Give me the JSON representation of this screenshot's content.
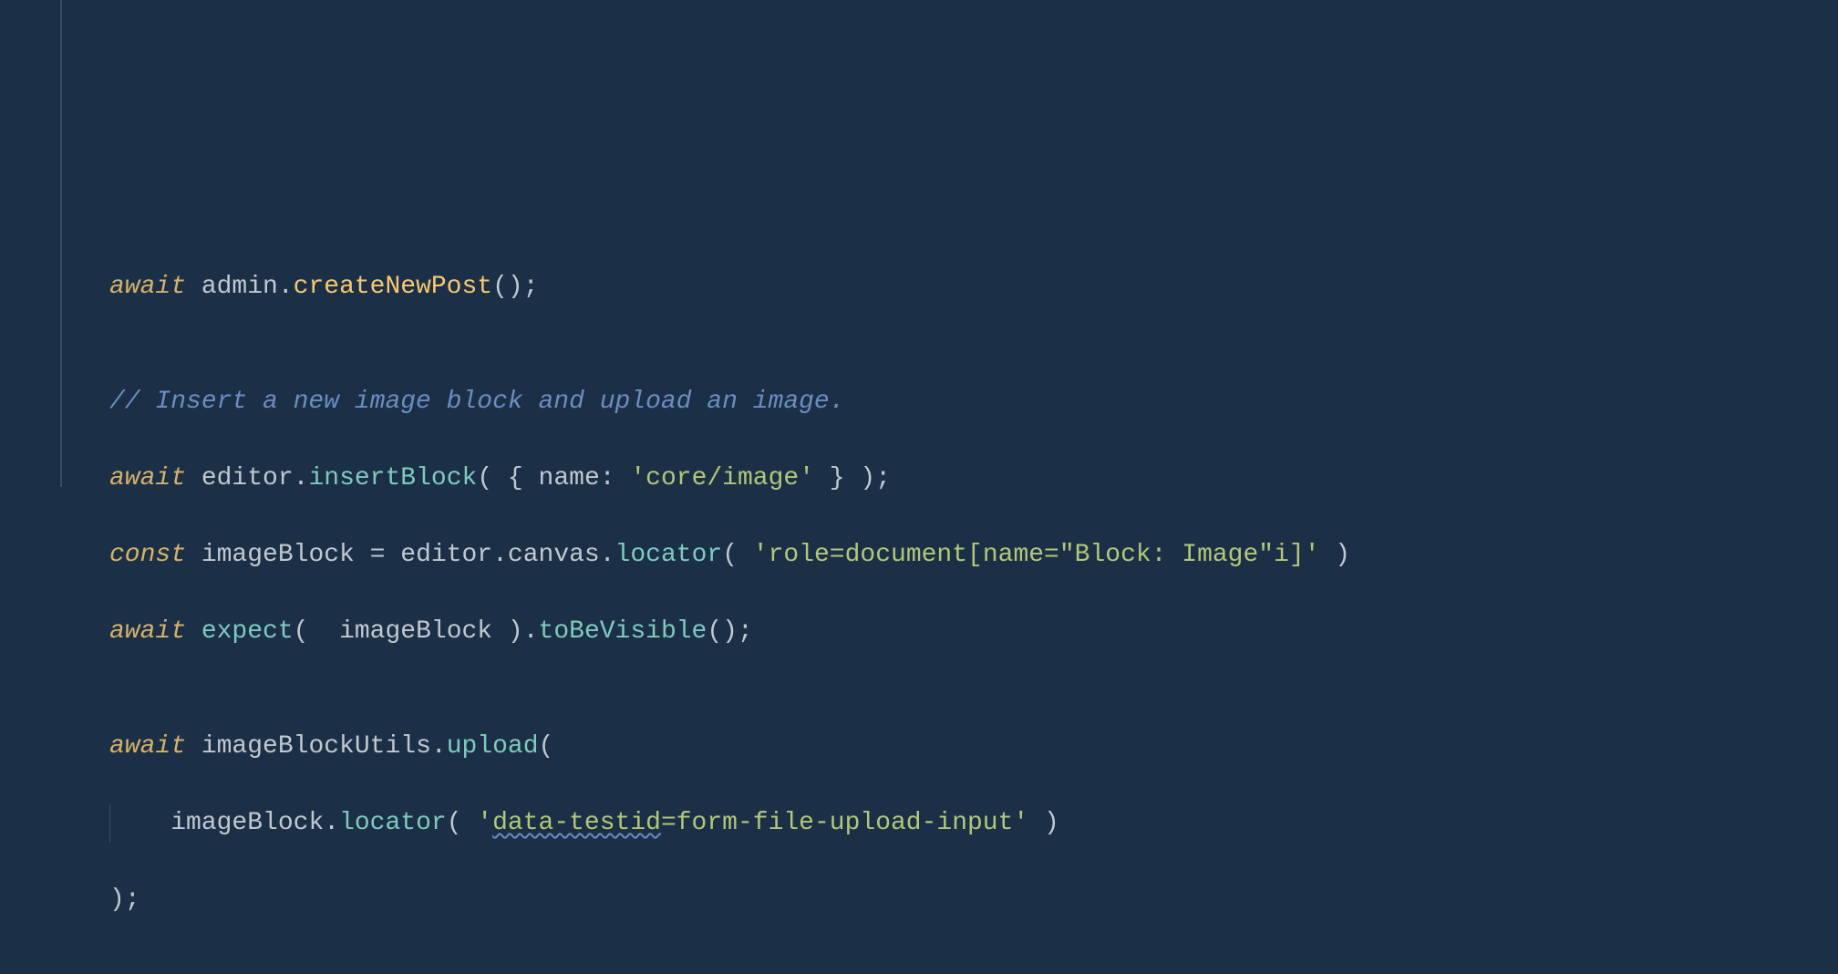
{
  "code": {
    "line1": {
      "await": "await",
      "obj": "admin",
      "method": "createNewPost",
      "parens": "()",
      "semi": ";"
    },
    "line3": {
      "comment": "// Insert a new image block and upload an image."
    },
    "line4": {
      "await": "await",
      "obj": "editor",
      "method": "insertBlock",
      "open": "( { ",
      "key": "name",
      "colon": ": ",
      "str": "'core/image'",
      "close": " } )",
      "semi": ";"
    },
    "line5": {
      "const": "const",
      "var": "imageBlock",
      "eq": " = ",
      "obj": "editor",
      "prop1": "canvas",
      "method": "locator",
      "open": "( ",
      "str": "'role=document[name=\"Block: Image\"i]'",
      "close": " )"
    },
    "line6": {
      "await": "await",
      "fn": "expect",
      "open": "( ",
      "arg": " imageBlock ",
      "close": ")",
      "method": "toBeVisible",
      "parens": "()",
      "semi": ";"
    },
    "line8": {
      "await": "await",
      "obj": "imageBlockUtils",
      "method": "upload",
      "open": "("
    },
    "line9": {
      "obj": "imageBlock",
      "method": "locator",
      "open": "( ",
      "str_pre": "'",
      "str_squiggle": "data-testid",
      "str_post": "=form-file-upload-input'",
      "close": " )"
    },
    "line10": {
      "close": ")",
      "semi": ";"
    }
  }
}
